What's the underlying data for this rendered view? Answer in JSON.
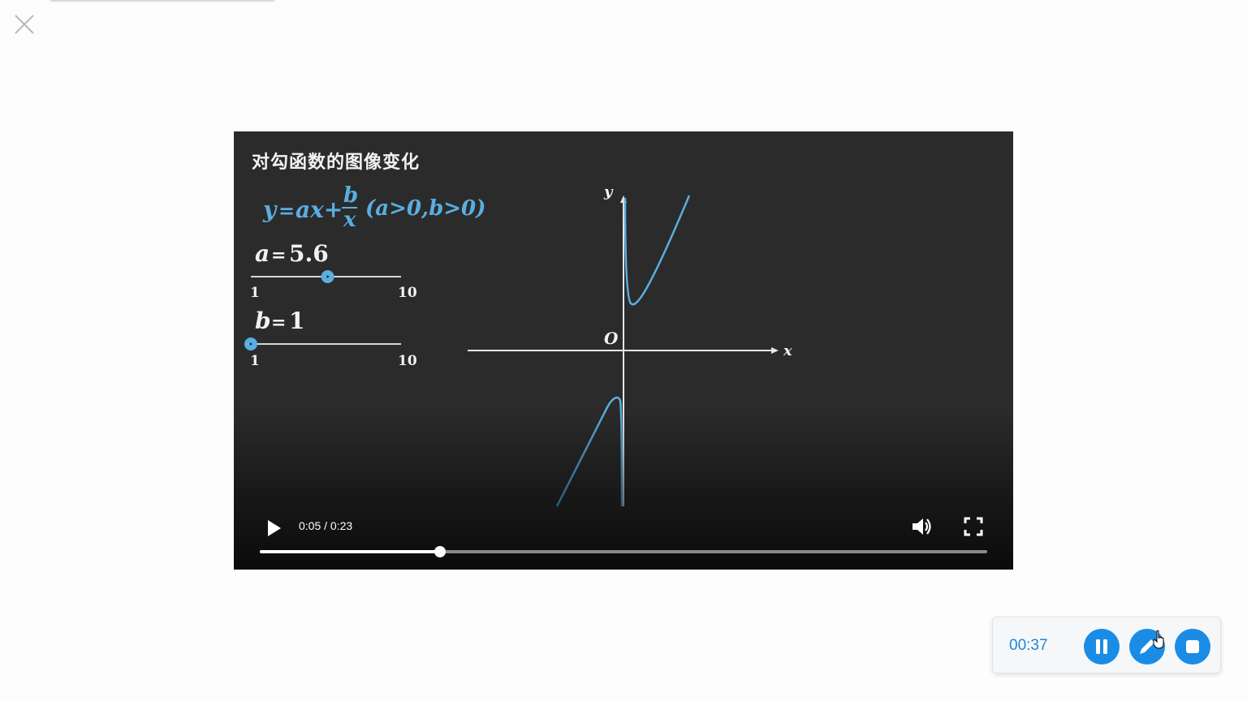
{
  "page": {
    "close_icon": "close-icon"
  },
  "video": {
    "title": "对勾函数的图像变化",
    "formula": {
      "lhs": "y",
      "eq": "=",
      "term": "ax+",
      "numerator": "b",
      "denominator": "x",
      "condition": "(a>0,b>0)"
    },
    "sliders": [
      {
        "label": "a",
        "eq": "=",
        "value": "5.6",
        "min_label": "1",
        "max_label": "10",
        "fraction": 0.5111
      },
      {
        "label": "b",
        "eq": "=",
        "value": "1",
        "min_label": "1",
        "max_label": "10",
        "fraction": 0.0
      }
    ],
    "graph": {
      "y_label": "y",
      "x_label": "x",
      "origin_label": "O"
    },
    "controls": {
      "time": "0:05 / 0:23",
      "progress_fraction": 0.248,
      "play_icon": "play-icon",
      "volume_icon": "volume-icon",
      "fullscreen_icon": "fullscreen-icon"
    }
  },
  "recorder": {
    "elapsed": "00:37",
    "pause_icon": "pause-icon",
    "pen_icon": "pen-icon",
    "stop_icon": "stop-icon"
  },
  "colors": {
    "accent_blue": "#1a8ce6",
    "curve_blue": "#5aaee0",
    "video_bg": "#2b2b2c"
  }
}
